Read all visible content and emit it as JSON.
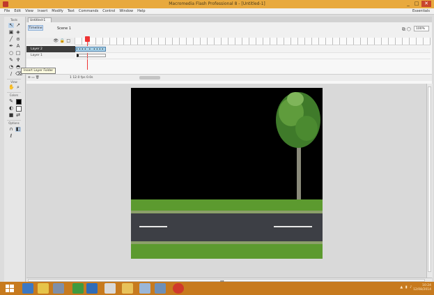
{
  "window": {
    "title": "Macromedia Flash Professional 8 - [Untitled-1]",
    "controls": [
      "_",
      "□",
      "✕"
    ]
  },
  "menubar": {
    "items": [
      "File",
      "Edit",
      "View",
      "Insert",
      "Modify",
      "Text",
      "Commands",
      "Control",
      "Window",
      "Help"
    ],
    "workspace": "Essentials"
  },
  "toolbox": {
    "sections": [
      "Tools",
      "View",
      "Colors",
      "Options"
    ]
  },
  "document": {
    "tab_label": "Untitled-1",
    "scene_badge": "Timeline",
    "scene_label": "Scene 1",
    "zoom": "100%"
  },
  "timeline": {
    "layers": [
      {
        "name": "Layer 2",
        "active": true
      },
      {
        "name": "Layer 1",
        "active": false
      }
    ],
    "tween_text": "•••• • ••••",
    "tooltip": "Insert Layer Folder",
    "status": {
      "frame": "1",
      "fps": "12.0 fps",
      "time": "0.0s"
    }
  },
  "colors": {
    "titlebar": "#e8a93e",
    "taskbar": "#c77a1e",
    "stage_background": "#000000",
    "grass": "#5c9a2f",
    "road": "#3d3f45",
    "tween": "#a9d3ea",
    "playhead": "#ee3333"
  },
  "taskbar": {
    "apps": [
      "ie-icon",
      "explorer-icon",
      "media-icon",
      "chrome-icon",
      "flash-icon",
      "word-icon",
      "folder-icon",
      "photoshop-icon",
      "opera-icon"
    ],
    "clock_time": "10:24",
    "clock_date": "12/08/2014"
  }
}
